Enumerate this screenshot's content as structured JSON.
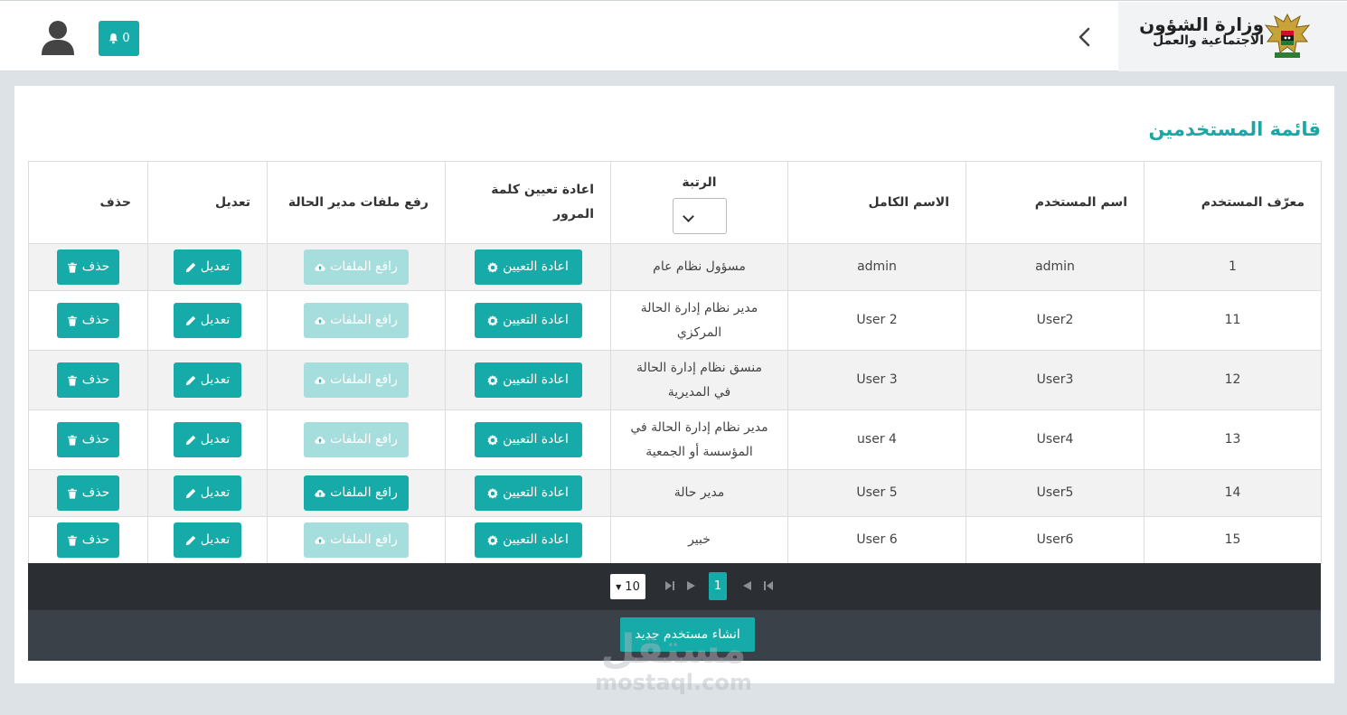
{
  "header": {
    "brand_line1": "وزارة الشؤون",
    "brand_line2": "الاجتماعية والعمل",
    "notifications_count": "0"
  },
  "page": {
    "title": "قائمة المستخدمين"
  },
  "table": {
    "headers": {
      "user_id": "معرّف المستخدم",
      "username": "اسم المستخدم",
      "full_name": "الاسم الكامل",
      "rank": "الرتبة",
      "reset_line1": "اعادة تعيين كلمة",
      "reset_line2": "المرور",
      "upload": "رفع ملفات مدير الحالة",
      "edit": "تعديل",
      "delete": "حذف"
    },
    "buttons": {
      "reset": "اعادة التعيين",
      "upload": "رافع الملفات",
      "edit": "تعديل",
      "delete": "حذف"
    },
    "rows": [
      {
        "id": "1",
        "username": "admin",
        "full_name": "admin",
        "rank_l1": "مسؤول نظام عام",
        "rank_l2": "",
        "upload_enabled": false
      },
      {
        "id": "11",
        "username": "User2",
        "full_name": "User 2",
        "rank_l1": "مدير نظام إدارة الحالة",
        "rank_l2": "المركزي",
        "upload_enabled": false
      },
      {
        "id": "12",
        "username": "User3",
        "full_name": "User 3",
        "rank_l1": "منسق نظام إدارة الحالة",
        "rank_l2": "في المديرية",
        "upload_enabled": false
      },
      {
        "id": "13",
        "username": "User4",
        "full_name": "user 4",
        "rank_l1": "مدير نظام إدارة الحالة في",
        "rank_l2": "المؤسسة أو الجمعية",
        "upload_enabled": false
      },
      {
        "id": "14",
        "username": "User5",
        "full_name": "User 5",
        "rank_l1": "مدير حالة",
        "rank_l2": "",
        "upload_enabled": true
      },
      {
        "id": "15",
        "username": "User6",
        "full_name": "User 6",
        "rank_l1": "خبير",
        "rank_l2": "",
        "upload_enabled": false
      }
    ]
  },
  "pagination": {
    "current_page": "1",
    "page_size": "10"
  },
  "footer": {
    "create_button": "انشاء مستخدم جديد"
  },
  "watermark": {
    "arabic": "مستقل",
    "latin": "mostaql.com"
  },
  "colors": {
    "accent": "#16aaa8",
    "accent_disabled": "#a6dede",
    "footer_dark": "#2b2f33"
  }
}
